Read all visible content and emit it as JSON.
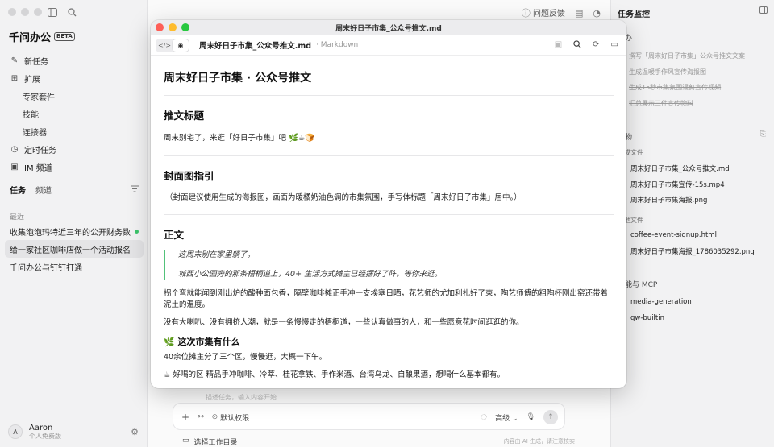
{
  "sidebar": {
    "brand_name": "千问办公",
    "brand_badge": "BETA",
    "nav": [
      {
        "label": "新任务",
        "icon": "edit-icon"
      },
      {
        "label": "扩展",
        "icon": "extension-icon"
      }
    ],
    "nav_sub": [
      "专家套件",
      "技能",
      "连接器"
    ],
    "nav2": [
      {
        "label": "定时任务",
        "icon": "clock-icon"
      },
      {
        "label": "IM 频道",
        "icon": "im-icon"
      }
    ],
    "tabs": {
      "active": "任务",
      "other": "频道"
    },
    "section_label": "最近",
    "tasks": [
      "收集泡泡玛特近三年的公开财务数据",
      "给一家社区咖啡店做一个活动报名页,",
      "千问办公与钉钉打通"
    ],
    "user": {
      "initial": "A",
      "name": "Aaron",
      "plan": "个人免费版"
    }
  },
  "main": {
    "feedback_label": "问题反馈",
    "composer_ghost": "描述任务，输入内容开始",
    "permission_label": "默认权限",
    "mode_label": "高级",
    "workdir_label": "选择工作目录",
    "disclaimer": "内容由 AI 生成，请注意核实"
  },
  "right": {
    "title": "任务监控",
    "todo_header": "待办",
    "todos": [
      "撰写「周末好日子市集」公众号推文文案",
      "生成温暖手作风宣传海报图",
      "生成15秒市集氛围混剪宣传视频",
      "汇总展示三件宣传物料"
    ],
    "output_header": "产物",
    "generated_label": "生成文件",
    "generated_files": [
      "周末好日子市集_公众号推文.md",
      "周末好日子市集宣传-15s.mp4",
      "周末好日子市集海报.png"
    ],
    "other_label": "其他文件",
    "other_files": [
      "coffee-event-signup.html",
      "周末好日子市集海报_1786035292.png"
    ],
    "skills_header": "技能与 MCP",
    "skills": [
      "media-generation",
      "qw-builtin"
    ]
  },
  "window": {
    "title": "周末好日子市集_公众号推文.md",
    "file_name": "周末好日子市集_公众号推文.md",
    "file_type": "· Markdown",
    "doc": {
      "h1": "周末好日子市集 · 公众号推文",
      "s1_title": "推文标题",
      "s1_text": "周末别宅了，来逛「好日子市集」吧 🌿☕🍞",
      "s2_title": "封面图指引",
      "s2_text": "（封面建议使用生成的海报图，画面为暖橘奶油色调的市集氛围，手写体标题「周末好日子市集」居中。）",
      "s3_title": "正文",
      "quote1": "这周末别在家里躺了。",
      "quote2": "城西小公园旁的那条梧桐道上，40+ 生活方式摊主已经摆好了阵，等你来逛。",
      "para1": "拐个弯就能闻到刚出炉的酸种面包香，隔壁咖啡摊正手冲一支埃塞日晒，花艺师的尤加利扎好了束，陶艺师傅的粗陶杯刚出窑还带着泥土的温度。",
      "para2": "没有大喇叭、没有拥挤人潮，就是一条慢慢走的梧桐道，一些认真做事的人，和一些愿意花时间逛逛的你。",
      "s4_title": "🌿 这次市集有什么",
      "para3": "40余位摊主分了三个区，慢慢逛，大概一下午。",
      "para4": "☕ 好喝的区 精品手冲咖啡、冷萃、桂花拿铁、手作米酒、台湾乌龙、自酿果酒，想喝什么基本都有。"
    }
  }
}
